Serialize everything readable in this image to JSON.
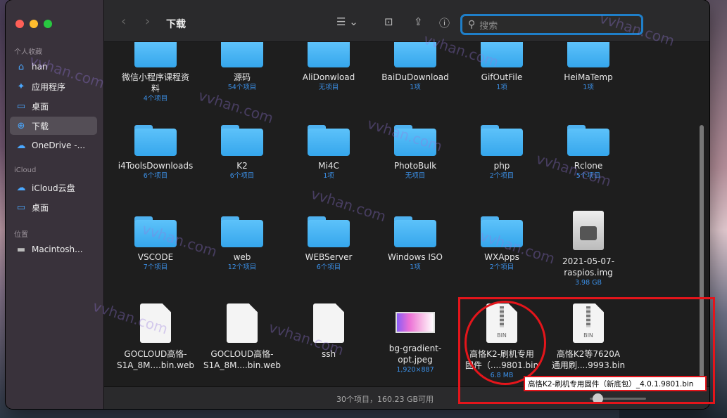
{
  "window": {
    "title": "下载"
  },
  "sidebar": {
    "favorites_title": "个人收藏",
    "favorites": [
      {
        "label": "han",
        "icon": "home-icon"
      },
      {
        "label": "应用程序",
        "icon": "applications-icon"
      },
      {
        "label": "桌面",
        "icon": "desktop-icon"
      },
      {
        "label": "下载",
        "icon": "downloads-icon",
        "active": true
      },
      {
        "label": "OneDrive -...",
        "icon": "cloud-icon"
      }
    ],
    "icloud_title": "iCloud",
    "icloud": [
      {
        "label": "iCloud云盘",
        "icon": "cloud-icon"
      },
      {
        "label": "桌面",
        "icon": "desktop-icon"
      }
    ],
    "locations_title": "位置",
    "locations": [
      {
        "label": "Macintosh...",
        "icon": "disk-icon"
      }
    ]
  },
  "toolbar": {
    "search_placeholder": "搜索"
  },
  "files": {
    "row1": [
      {
        "name": "微信小程序课程资",
        "name2": "料",
        "sub": "4个项目"
      },
      {
        "name": "源码",
        "sub": "54个项目"
      },
      {
        "name": "AliDonwload",
        "sub": "无项目"
      },
      {
        "name": "BaiDuDownload",
        "sub": "1项"
      },
      {
        "name": "GifOutFile",
        "sub": "1项"
      },
      {
        "name": "HeiMaTemp",
        "sub": "1项"
      }
    ],
    "row2": [
      {
        "name": "i4ToolsDownloads",
        "sub": "6个项目"
      },
      {
        "name": "K2",
        "sub": "6个项目"
      },
      {
        "name": "Mi4C",
        "sub": "1项"
      },
      {
        "name": "PhotoBulk",
        "sub": "无项目"
      },
      {
        "name": "php",
        "sub": "2个项目"
      },
      {
        "name": "Rclone",
        "sub": "5个项目"
      }
    ],
    "row3": [
      {
        "name": "VSCODE",
        "sub": "7个项目"
      },
      {
        "name": "web",
        "sub": "12个项目"
      },
      {
        "name": "WEBServer",
        "sub": "6个项目"
      },
      {
        "name": "Windows ISO",
        "sub": "1项"
      },
      {
        "name": "WXApps",
        "sub": "2个项目"
      },
      {
        "name": "2021-05-07-",
        "name2": "raspios.img",
        "sub": "3.98 GB"
      }
    ],
    "row4": [
      {
        "name": "GOCLOUD高恪-",
        "name2": "S1A_8M....bin.web",
        "sub": ""
      },
      {
        "name": "GOCLOUD高恪-",
        "name2": "S1A_8M....bin.web",
        "sub": ""
      },
      {
        "name": "ssh",
        "sub": ""
      },
      {
        "name": "bg-gradient-",
        "name2": "opt.jpeg",
        "sub": "1,920×887"
      },
      {
        "name": "高恪K2-刷机专用",
        "name2": "固件（....9801.bin",
        "sub": "6.8 MB",
        "tag": "BIN"
      },
      {
        "name": "高恪K2等7620A",
        "name2": "通用刷....9993.bin",
        "sub": "",
        "tag": "BIN"
      }
    ]
  },
  "tooltip": "高恪K2-刷机专用固件（新底包）_4.0.1.9801.bin",
  "status": {
    "text": "30个项目，160.23 GB可用"
  },
  "watermark": "vvhan.com"
}
